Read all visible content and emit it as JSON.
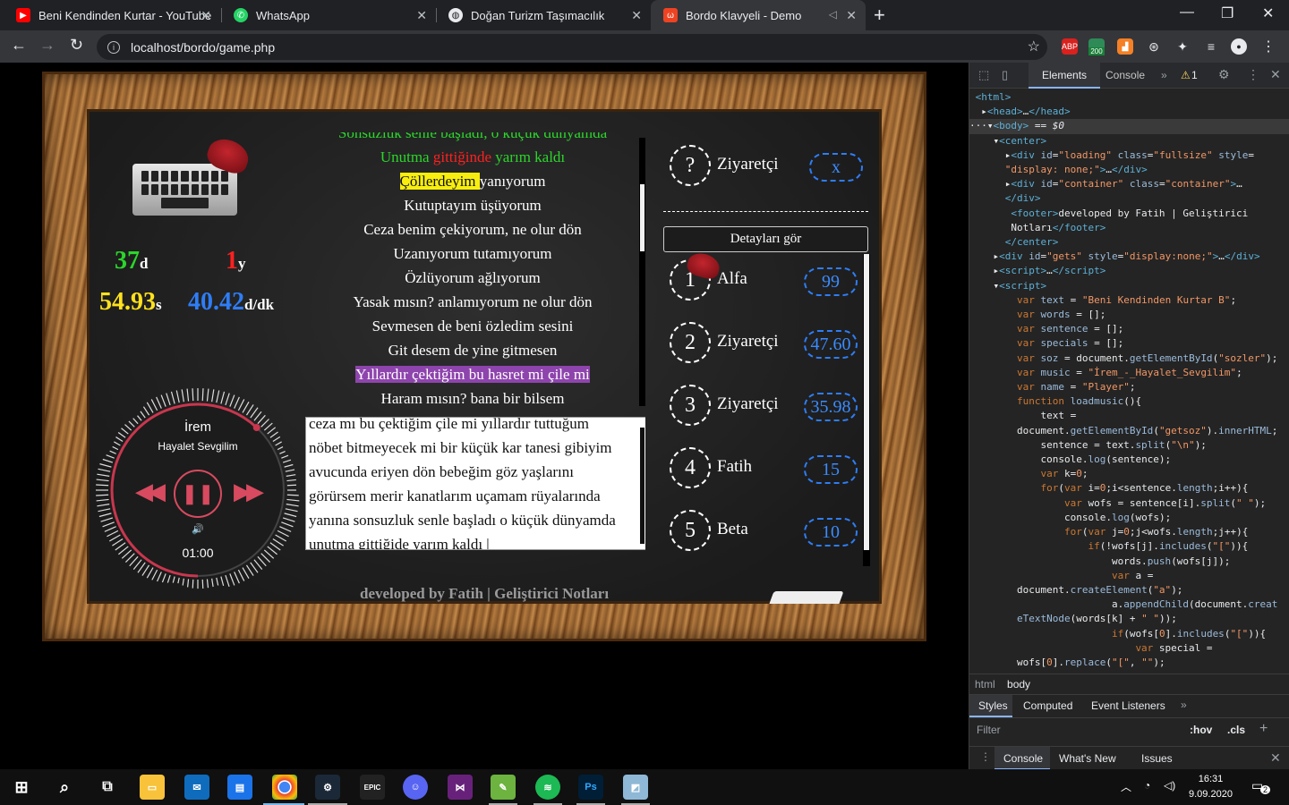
{
  "browser": {
    "tabs": [
      {
        "title": "Beni Kendinden Kurtar - YouTube",
        "icon": "youtube-icon",
        "color": "#ff0000"
      },
      {
        "title": "WhatsApp",
        "icon": "whatsapp-icon",
        "color": "#25d366"
      },
      {
        "title": "Doğan Turizm Taşımacılık",
        "icon": "globe-icon",
        "color": "#9aa0a6"
      },
      {
        "title": "Bordo Klavyeli - Demo",
        "icon": "codeigniter-icon",
        "color": "#ee4323"
      }
    ],
    "url": "localhost/bordo/game.php",
    "ext_badge": "200"
  },
  "game": {
    "stats": {
      "correct": "37",
      "correct_unit": "d",
      "wrong": "1",
      "wrong_unit": "y",
      "time": "54.93",
      "time_unit": "s",
      "wpm": "40.42",
      "wpm_unit": "d/dk"
    },
    "lyrics_lines": [
      "Sonsuzluk senle başladı, o küçük dünyamda",
      "Unutma gittiğinde yarım kaldı",
      "Çöllerdeyim yanıyorum",
      "Kutuptayım üşüyorum",
      "Ceza benim çekiyorum, ne olur dön",
      "Uzanıyorum tutamıyorum",
      "Özlüyorum ağlıyorum",
      "Yasak mısın? anlamıyorum ne olur dön",
      "Sevmesen de beni özledim sesini",
      "Git desem de yine gitmesen",
      "Yıllardır çektiğim bu hasret mi çile mi",
      "Haram mısın? bana bir bilsem"
    ],
    "lyrics_green": "Sonsuzluk senle başladı, o küçük dünyamda",
    "lyrics_l2_a": "Unutma ",
    "lyrics_l2_b": "gittiğinde",
    "lyrics_l2_c": " yarım kaldı",
    "lyrics_l3_a": "Çöllerdeyim ",
    "lyrics_l3_b": "yanıyorum",
    "typed_lines": [
      "ceza mı bu çektiğim çile mi yıllardır tuttuğum",
      "nöbet bitmeyecek mi bir küçük kar tanesi gibiyim",
      "avucunda eriyen dön bebeğim göz yaşlarını",
      "görürsem merir kanatlarım uçamam rüyalarında",
      "yanına sonsuzluk senle başladı o küçük dünyamda",
      "unutma gittiğide yarım kaldı |"
    ],
    "player": {
      "artist": "İrem",
      "song": "Hayalet Sevgilim",
      "time": "01:00",
      "progress": 0.62
    },
    "visitor": {
      "rank": "?",
      "name": "Ziyaretçi",
      "score": "x"
    },
    "details_button": "Detayları gör",
    "leaderboard": [
      {
        "rank": "1",
        "name": "Alfa",
        "score": "99"
      },
      {
        "rank": "2",
        "name": "Ziyaretçi",
        "score": "47.60"
      },
      {
        "rank": "3",
        "name": "Ziyaretçi",
        "score": "35.98"
      },
      {
        "rank": "4",
        "name": "Fatih",
        "score": "15"
      },
      {
        "rank": "5",
        "name": "Beta",
        "score": "10"
      }
    ],
    "footer": "developed by Fatih | Geliştirici Notları"
  },
  "devtools": {
    "tabs": [
      "Elements",
      "Console"
    ],
    "warning_count": "1",
    "breadcrumb": [
      "html",
      "body"
    ],
    "style_tabs": [
      "Styles",
      "Computed",
      "Event Listeners"
    ],
    "filter_placeholder": "Filter",
    "filter_hov": ":hov",
    "filter_cls": ".cls",
    "drawer_tabs": [
      "Console",
      "What's New",
      "Issues"
    ]
  },
  "taskbar": {
    "time": "16:31",
    "date": "9.09.2020",
    "notifications": "2"
  },
  "colors": {
    "green": "#2bd62b",
    "red": "#ff2020",
    "yellow": "#ffe11c",
    "blue": "#2e7df6",
    "accent": "#8a1524"
  }
}
